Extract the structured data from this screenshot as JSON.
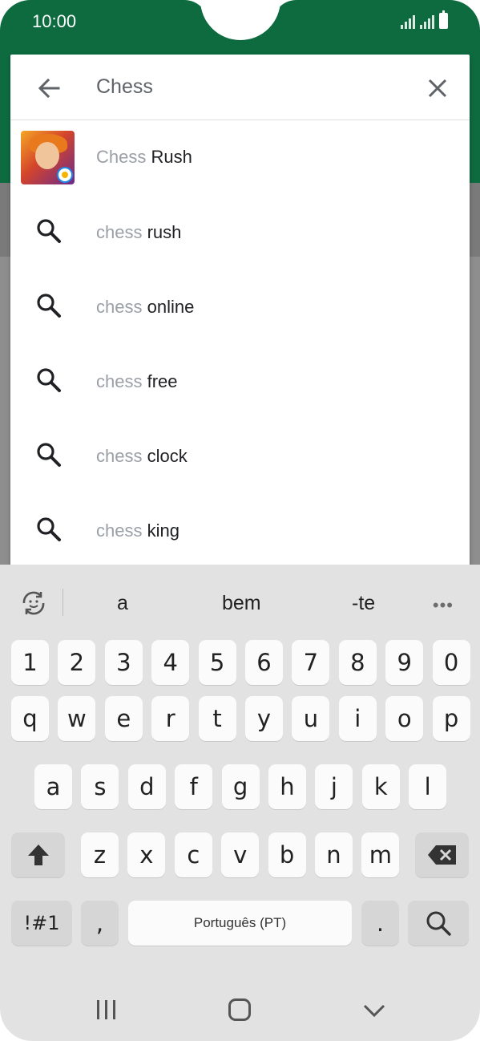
{
  "status_bar": {
    "time": "10:00",
    "icons": [
      "signal-icon",
      "signal-icon",
      "battery-icon"
    ]
  },
  "colors": {
    "brand_green": "#0d6b3f",
    "query_gray": "#9aa0a6",
    "keyboard_bg": "#e2e2e2"
  },
  "search": {
    "query": "Chess",
    "back_icon": "arrow-back-icon",
    "clear_icon": "close-icon",
    "app_suggestion": {
      "query_part": "Chess",
      "rest": " Rush",
      "icon": "chess-rush-app-icon"
    },
    "suggestions": [
      {
        "query_part": "chess",
        "rest": " rush",
        "icon": "search-icon"
      },
      {
        "query_part": "chess",
        "rest": " online",
        "icon": "search-icon"
      },
      {
        "query_part": "chess",
        "rest": " free",
        "icon": "search-icon"
      },
      {
        "query_part": "chess",
        "rest": " clock",
        "icon": "search-icon"
      },
      {
        "query_part": "chess",
        "rest": " king",
        "icon": "search-icon"
      }
    ]
  },
  "keyboard": {
    "predictions": [
      "a",
      "bem",
      "-te"
    ],
    "more_icon": "more-dots-icon",
    "emoji_icon": "emoji-refresh-icon",
    "number_row": [
      "1",
      "2",
      "3",
      "4",
      "5",
      "6",
      "7",
      "8",
      "9",
      "0"
    ],
    "row1": [
      "q",
      "w",
      "e",
      "r",
      "t",
      "y",
      "u",
      "i",
      "o",
      "p"
    ],
    "row2": [
      "a",
      "s",
      "d",
      "f",
      "g",
      "h",
      "j",
      "k",
      "l"
    ],
    "row3": [
      "z",
      "x",
      "c",
      "v",
      "b",
      "n",
      "m"
    ],
    "shift_icon": "shift-arrow-icon",
    "backspace_icon": "backspace-icon",
    "symbols_label": "!#1",
    "comma_label": ",",
    "space_label": "Português (PT)",
    "period_label": ".",
    "search_key_icon": "search-icon"
  },
  "nav_bar": {
    "recents_icon": "recents-icon",
    "home_icon": "home-icon",
    "back_icon": "chevron-down-icon"
  }
}
